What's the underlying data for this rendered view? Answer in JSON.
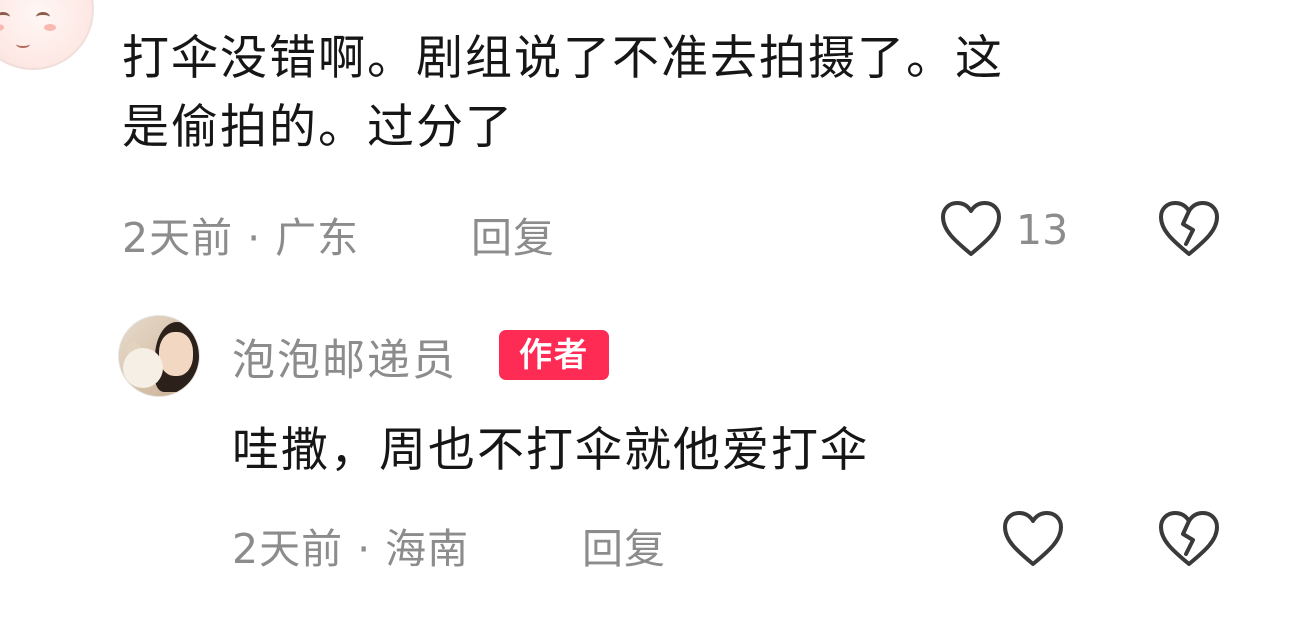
{
  "comments": [
    {
      "text_line1": "打伞没错啊。剧组说了不准去拍摄了。这",
      "text_line2": "是偷拍的。过分了",
      "time": "2天前",
      "separator": "·",
      "location": "广东",
      "reply_label": "回复",
      "likes": "13"
    },
    {
      "username": "泡泡邮递员",
      "badge": "作者",
      "text": "哇撒，周也不打伞就他爱打伞",
      "time": "2天前",
      "separator": "·",
      "location": "海南",
      "reply_label": "回复",
      "likes": ""
    }
  ],
  "icons": {
    "like": "heart-outline-icon",
    "dislike": "broken-heart-icon"
  },
  "colors": {
    "badge": "#fe2c55",
    "meta_text": "#8c8c8c",
    "body_text": "#161616",
    "icon_stroke": "#3a3a3a"
  }
}
